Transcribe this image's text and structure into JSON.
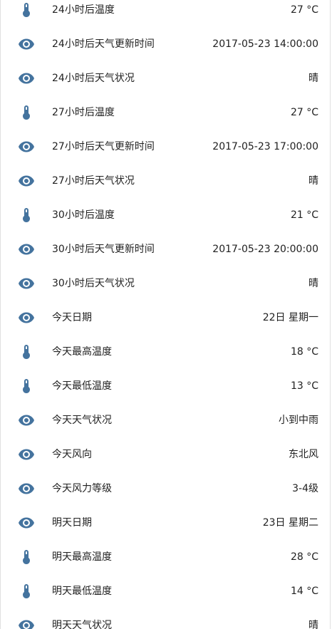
{
  "colors": {
    "icon": "#44739e",
    "text": "#212121"
  },
  "rows": [
    {
      "icon": "thermometer-icon",
      "label": "24小时后温度",
      "value": "27 °C"
    },
    {
      "icon": "eye-icon",
      "label": "24小时后天气更新时间",
      "value": "2017-05-23 14:00:00"
    },
    {
      "icon": "eye-icon",
      "label": "24小时后天气状况",
      "value": "晴"
    },
    {
      "icon": "thermometer-icon",
      "label": "27小时后温度",
      "value": "27 °C"
    },
    {
      "icon": "eye-icon",
      "label": "27小时后天气更新时间",
      "value": "2017-05-23 17:00:00"
    },
    {
      "icon": "eye-icon",
      "label": "27小时后天气状况",
      "value": "晴"
    },
    {
      "icon": "thermometer-icon",
      "label": "30小时后温度",
      "value": "21 °C"
    },
    {
      "icon": "eye-icon",
      "label": "30小时后天气更新时间",
      "value": "2017-05-23 20:00:00"
    },
    {
      "icon": "eye-icon",
      "label": "30小时后天气状况",
      "value": "晴"
    },
    {
      "icon": "eye-icon",
      "label": "今天日期",
      "value": "22日 星期一"
    },
    {
      "icon": "thermometer-icon",
      "label": "今天最高温度",
      "value": "18 °C"
    },
    {
      "icon": "thermometer-icon",
      "label": "今天最低温度",
      "value": "13 °C"
    },
    {
      "icon": "eye-icon",
      "label": "今天天气状况",
      "value": "小到中雨"
    },
    {
      "icon": "eye-icon",
      "label": "今天风向",
      "value": "东北风"
    },
    {
      "icon": "eye-icon",
      "label": "今天风力等级",
      "value": "3-4级"
    },
    {
      "icon": "eye-icon",
      "label": "明天日期",
      "value": "23日 星期二"
    },
    {
      "icon": "thermometer-icon",
      "label": "明天最高温度",
      "value": "28 °C"
    },
    {
      "icon": "thermometer-icon",
      "label": "明天最低温度",
      "value": "14 °C"
    },
    {
      "icon": "eye-icon",
      "label": "明天天气状况",
      "value": "晴"
    }
  ]
}
